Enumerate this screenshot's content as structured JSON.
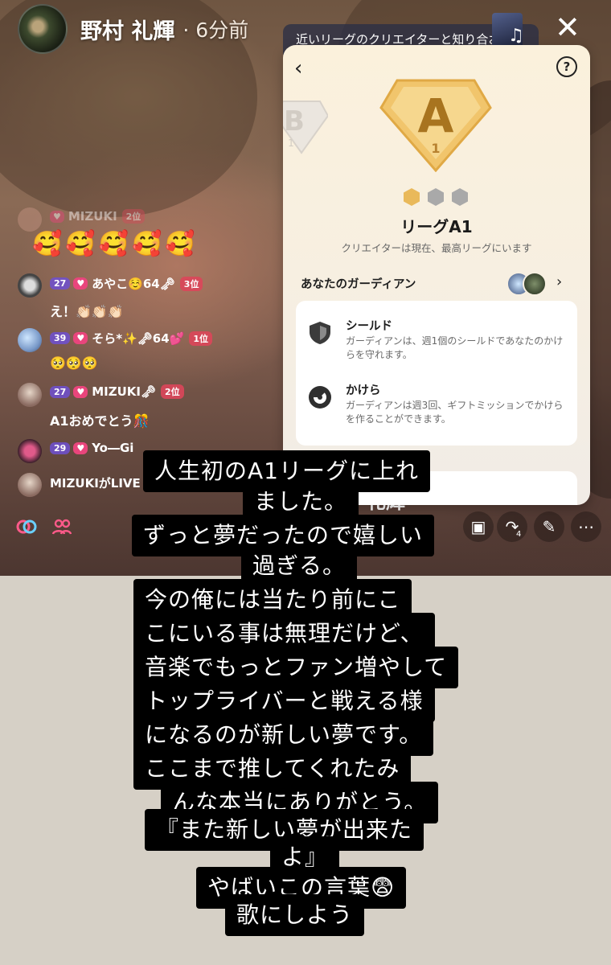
{
  "header": {
    "host_name": "野村 礼輝",
    "time_ago": "· 6分前",
    "close_glyph": "✕"
  },
  "banner": {
    "text": "近いリーグのクリエイターと知り合お",
    "note_glyph": "♫"
  },
  "chat": [
    {
      "name": "MIZUKI",
      "level": "",
      "rank": "2位",
      "message": "🥰🥰🥰🥰🥰"
    },
    {
      "level": "27",
      "name": "あやこ☺️64🗝",
      "rank": "3位",
      "message": "え！👏🏻👏🏻👏🏻"
    },
    {
      "level": "39",
      "name": "そら*✨🗝64💕",
      "rank": "1位",
      "message": "🥺🥺🥺"
    },
    {
      "level": "27",
      "name": "MIZUKI🗝",
      "rank": "2位",
      "message": "A1おめでとう🎊"
    },
    {
      "level": "29",
      "name": "Yo―Gi",
      "rank": "",
      "message": ""
    },
    {
      "level": "",
      "name": "MIZUKIがLIVE",
      "rank": "",
      "message": ""
    }
  ],
  "panel": {
    "back_glyph": "‹",
    "help_glyph": "?",
    "current_badge_letter": "A",
    "current_badge_number": "1",
    "prev_badge_letter": "B",
    "prev_badge_number": "1",
    "league_title": "リーグA1",
    "league_subtitle": "クリエイターは現在、最高リーグにいます",
    "guardian_label": "あなたのガーディアン",
    "guardian_chevron": "›",
    "features": [
      {
        "icon": "shield-icon",
        "title": "シールド",
        "description": "ガーディアンは、週1個のシールドであなたのかけらを守れます。"
      },
      {
        "icon": "fragment-icon",
        "title": "かけら",
        "description": "ガーディアンは週3回、ギフトミッションでかけらを作ることができます。"
      }
    ],
    "colors": {
      "gold": "#e9b95a",
      "gold_dark": "#a8741f",
      "inactive": "#9a9a9a"
    }
  },
  "bottom_bar": {
    "share_count": "4"
  },
  "caption_lines": [
    "人生初のA1リーグに上れ",
    "ました。",
    "ずっと夢だったので嬉しい",
    "過ぎる。",
    "今の俺には当たり前にこ",
    "こにいる事は無理だけど、",
    "音楽でもっとファン増やして",
    "トップライバーと戦える様",
    "になるのが新しい夢です。",
    "ここまで推してくれたみ",
    "んな本当にありがとう。",
    "『また新しい夢が出来た",
    "よ』",
    "やばいこの言葉😨",
    "歌にしよう"
  ],
  "stream_host_partial": "礼輝"
}
